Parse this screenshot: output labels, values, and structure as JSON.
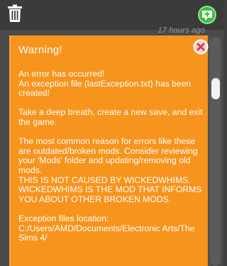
{
  "timestamp": "17 hours ago",
  "icons": {
    "trash": "trash-icon",
    "add": "add-notification-icon",
    "close": "close-icon"
  },
  "colors": {
    "card_bg": "#f7941d",
    "panel_bg": "#4a4a4a",
    "add_green": "#3fbf3f",
    "close_red": "#e03c3c"
  },
  "card": {
    "title": "Warning!",
    "paragraphs": [
      "An error has occurred!\nAn exception file (lastException.txt) has been created!",
      "Take a deep breath, create a new save, and exit the game.",
      "The most common reason for errors like these are outdated/broken mods. Consider reviewing your 'Mods' folder and updating/removing old mods.\nTHIS IS NOT CAUSED BY WICKEDWHIMS. WICKEDWHIMS IS THE MOD THAT INFORMS YOU ABOUT OTHER BROKEN MODS.",
      "Exception files location:\nC:/Users/AMD/Documents/Electronic Arts/The Sims 4/"
    ]
  }
}
